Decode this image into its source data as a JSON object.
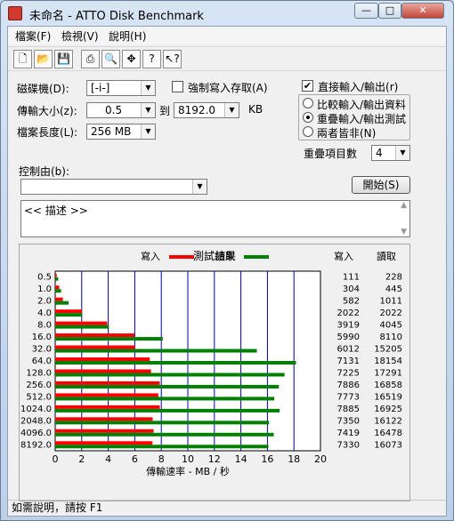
{
  "window": {
    "title": "未命名 - ATTO Disk Benchmark",
    "min": "—",
    "max": "□",
    "close": "✕"
  },
  "menu": [
    "檔案(F)",
    "檢視(V)",
    "說明(H)"
  ],
  "toolbar": [
    "new-file-icon",
    "open-folder-icon",
    "save-icon",
    "print-icon",
    "print-preview-icon",
    "move-icon",
    "help-icon",
    "context-help-icon"
  ],
  "form": {
    "drive_label": "磁碟機(D):",
    "drive_value": "[-i-]",
    "force_write_label": "強制寫入存取(A)",
    "force_write_checked": false,
    "direct_io_label": "直接輸入/輸出(r)",
    "direct_io_checked": true,
    "transfer_label": "傳輸大小(z):",
    "transfer_from": "0.5",
    "to_label": "到",
    "transfer_to": "8192.0",
    "unit": "KB",
    "length_label": "檔案長度(L):",
    "length_value": "256 MB",
    "radio_options": [
      "比較輸入/輸出資料",
      "重疊輸入/輸出測試",
      "兩者皆非(N)"
    ],
    "radio_selected": 1,
    "queue_label": "重疊項目數",
    "queue_value": "4",
    "controlled_by_label": "控制由(b):",
    "controlled_by_value": "",
    "start_button": "開始(S)",
    "description": "<<    描述    >>"
  },
  "results_title": "測試結果",
  "status": "如需說明，請按 F1",
  "chart_data": {
    "type": "bar",
    "legend": {
      "write": "寫入",
      "read": "讀取"
    },
    "colors": {
      "write": "#ff0000",
      "read": "#008000"
    },
    "xlabel": "傳輸速率 - MB / 秒",
    "xlim": [
      0,
      20
    ],
    "xticks": [
      "0",
      "2",
      "4",
      "6",
      "8",
      "10",
      "12",
      "14",
      "16",
      "18",
      "20"
    ],
    "categories": [
      "0.5",
      "1.0",
      "2.0",
      "4.0",
      "8.0",
      "16.0",
      "32.0",
      "64.0",
      "128.0",
      "256.0",
      "512.0",
      "1024.0",
      "2048.0",
      "4096.0",
      "8192.0"
    ],
    "series": [
      {
        "name": "寫入",
        "values": [
          111,
          304,
          582,
          2022,
          3919,
          5990,
          6012,
          7131,
          7225,
          7886,
          7773,
          7885,
          7350,
          7419,
          7330
        ]
      },
      {
        "name": "讀取",
        "values": [
          228,
          445,
          1011,
          2022,
          4045,
          8110,
          15205,
          18154,
          17291,
          16858,
          16519,
          16925,
          16122,
          16478,
          16073
        ]
      }
    ],
    "write_header": "寫入",
    "read_header": "讀取"
  }
}
